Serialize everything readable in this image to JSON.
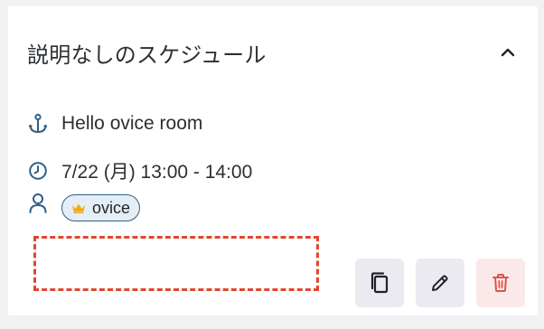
{
  "card": {
    "title": "説明なしのスケジュール",
    "room": "Hello ovice room",
    "datetime": "7/22 (月) 13:00 - 14:00",
    "members": [
      {
        "name": "ovice",
        "role_icon": "crown-icon"
      }
    ]
  },
  "icons": {
    "collapse": "chevron-up-icon",
    "room": "anchor-icon",
    "time": "clock-icon",
    "members": "person-icon",
    "copy": "copy-icon",
    "edit": "pencil-icon",
    "delete": "trash-icon"
  },
  "colors": {
    "icon_accent": "#2f5f86",
    "crown": "#f0a81c",
    "dashed_highlight": "#e0472f",
    "delete_icon": "#e0524a"
  }
}
